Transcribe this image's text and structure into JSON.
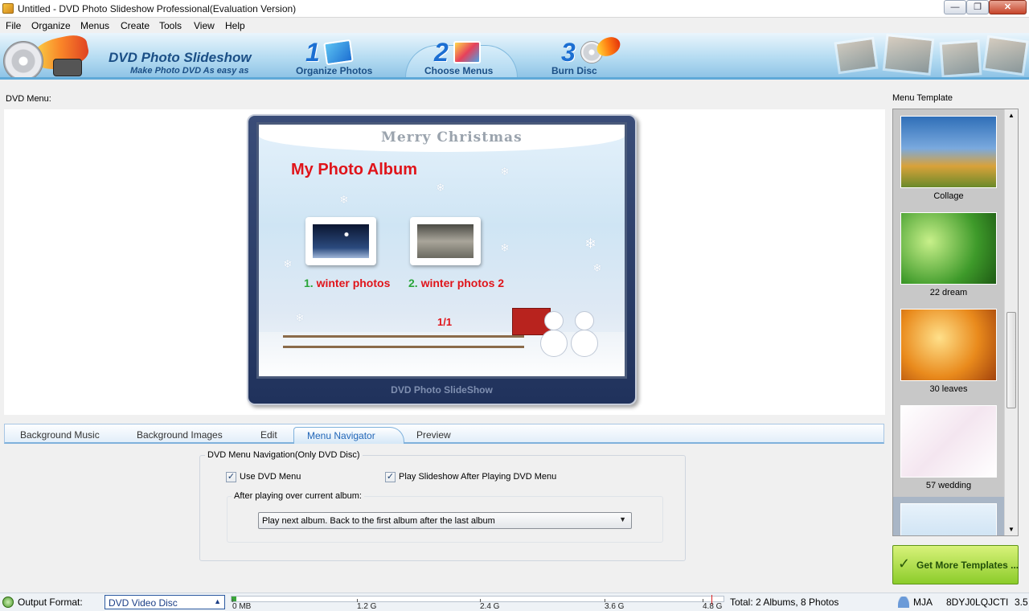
{
  "window": {
    "title": "Untitled - DVD Photo Slideshow Professional(Evaluation Version)",
    "minimize": "—",
    "maximize": "❐",
    "close": "✕"
  },
  "menu": [
    "File",
    "Organize",
    "Menus",
    "Create",
    "Tools",
    "View",
    "Help"
  ],
  "banner": {
    "app_name": "DVD Photo Slideshow",
    "tagline": "Make Photo DVD As easy as",
    "steps": [
      {
        "num": "1",
        "label": "Organize Photos"
      },
      {
        "num": "2",
        "label": "Choose Menus"
      },
      {
        "num": "3",
        "label": "Burn Disc"
      }
    ],
    "active_step": 2
  },
  "dvd_menu_label": "DVD Menu:",
  "preview": {
    "header": "Merry  Christmas",
    "album_title": "My Photo Album",
    "items": [
      {
        "num": "1.",
        "label": "winter photos"
      },
      {
        "num": "2.",
        "label": "winter photos 2"
      }
    ],
    "page_indicator": "1/1",
    "brand": "DVD Photo SlideShow"
  },
  "tabs": [
    "Background Music",
    "Background Images",
    "Edit",
    "Menu Navigator",
    "Preview"
  ],
  "active_tab": "Menu Navigator",
  "navigator": {
    "group_legend": "DVD Menu Navigation(Only DVD Disc)",
    "use_dvd_menu": {
      "label": "Use DVD Menu",
      "checked": true,
      "mark": "✓"
    },
    "play_slideshow": {
      "label": "Play Slideshow After Playing DVD Menu",
      "checked": true,
      "mark": "✓"
    },
    "after_playing_legend": "After playing over current album:",
    "after_playing_value": "Play next album. Back to the first album after the last album",
    "dropdown_arrow": "▼"
  },
  "templates": {
    "label": "Menu Template",
    "items": [
      "Collage",
      "22 dream",
      "30 leaves",
      "57 wedding",
      ""
    ],
    "selected_index": 4,
    "get_more": "Get More Templates ...",
    "get_more_icon": "✓",
    "scroll_up": "▲",
    "scroll_down": "▼"
  },
  "status": {
    "output_format_label": "Output Format:",
    "output_format_value": "DVD Video Disc",
    "format_arrow": "▲",
    "capacity_ticks": [
      "0 MB",
      "1.2 G",
      "2.4 G",
      "3.6 G",
      "4.8 G"
    ],
    "capacity_used_fraction": 0.01,
    "total": "Total: 2 Albums, 8 Photos",
    "user": "MJA",
    "machine_code": "8DYJ0LQJCTI",
    "version": "3.5"
  },
  "colors": {
    "accent": "#1c6fd2",
    "album_title": "#e0141a",
    "item_number": "#2aa63a",
    "get_more": "#8ccc2a"
  }
}
